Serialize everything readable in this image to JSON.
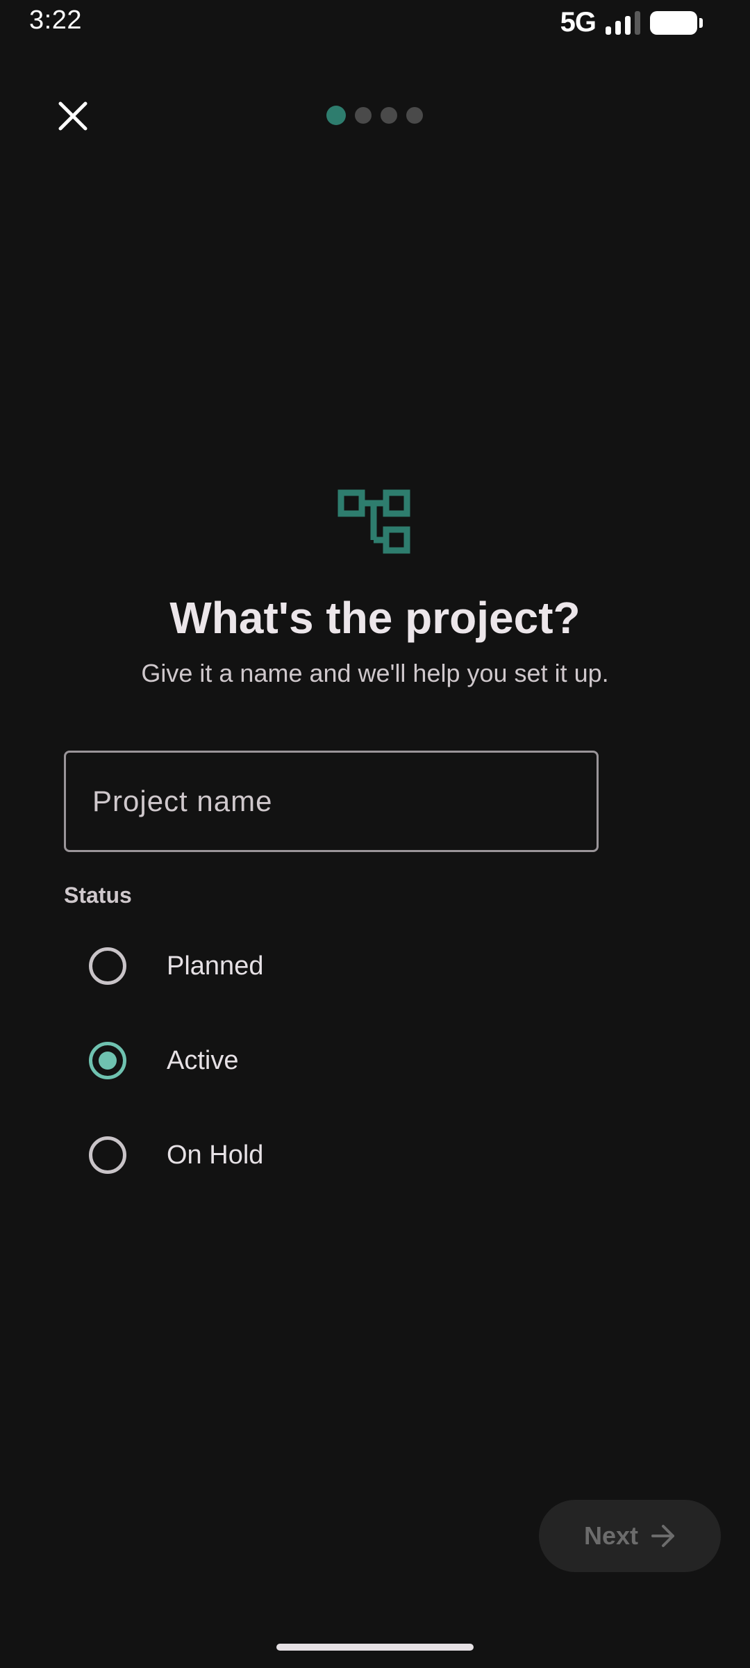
{
  "status_bar": {
    "time": "3:22",
    "network": "5G",
    "icons": [
      "signal-icon",
      "battery-icon"
    ]
  },
  "top_bar": {
    "close_icon": "close-icon",
    "stepper": {
      "total_steps": 4,
      "current_step": 1
    }
  },
  "hero": {
    "icon": "project-tree-icon",
    "title": "What's the project?",
    "subtitle": "Give it a name and we'll help you set it up."
  },
  "form": {
    "project_name": {
      "value": "",
      "placeholder": "Project name"
    },
    "status": {
      "label": "Status",
      "options": [
        {
          "label": "Planned",
          "selected": false
        },
        {
          "label": "Active",
          "selected": true
        },
        {
          "label": "On Hold",
          "selected": false
        }
      ]
    }
  },
  "footer": {
    "next_label": "Next",
    "next_icon": "arrow-right-icon"
  },
  "colors": {
    "background": "#121212",
    "accent": "#2e7d6e",
    "radio_selected": "#6fc2b0",
    "text": "#e6e1e5",
    "muted_text": "#cfc8cc",
    "button_disabled_bg": "#242424",
    "button_disabled_text": "#6c6c6c"
  }
}
